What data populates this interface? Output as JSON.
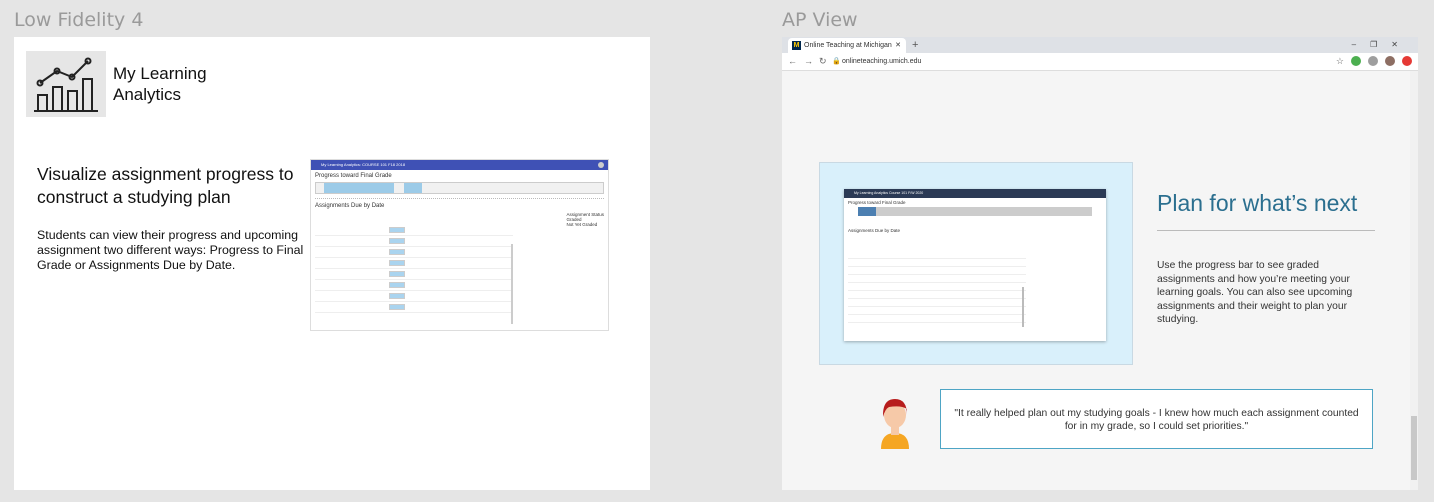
{
  "frames": {
    "left_title": "Low Fidelity 4",
    "right_title": "AP View"
  },
  "low_fi": {
    "app_name_line1": "My Learning",
    "app_name_line2": "Analytics",
    "hero": "Visualize assignment progress to construct a studying plan",
    "description": "Students can view their progress and upcoming assignment two different ways: Progress to Final Grade or Assignments Due by Date.",
    "mini_dashboard": {
      "topbar": "My Learning Analytics: COURSE 101 F18 2018",
      "progress_title": "Progress toward Final Grade",
      "due_title": "Assignments Due by Date",
      "status_title": "Assignment Status",
      "status_items": [
        "Graded",
        "Not Yet Graded"
      ]
    }
  },
  "ap_view": {
    "tab_title": "Online Teaching at Michigan",
    "favicon_letter": "M",
    "url": "onlineteaching.umich.edu",
    "screenshot_topbar": "My Learning Analytics   Course 101 F/W 2020",
    "screenshot_progress": "Progress toward Final Grade",
    "screenshot_due": "Assignments Due by Date",
    "heading": "Plan for what’s next",
    "paragraph": "Use the progress bar to see graded assignments and how you’re meeting your learning goals. You can also see upcoming assignments and their weight to plan your studying.",
    "quote": "\"It really helped plan out my studying goals - I knew how much each assignment counted for in my grade, so I could set priorities.\""
  }
}
